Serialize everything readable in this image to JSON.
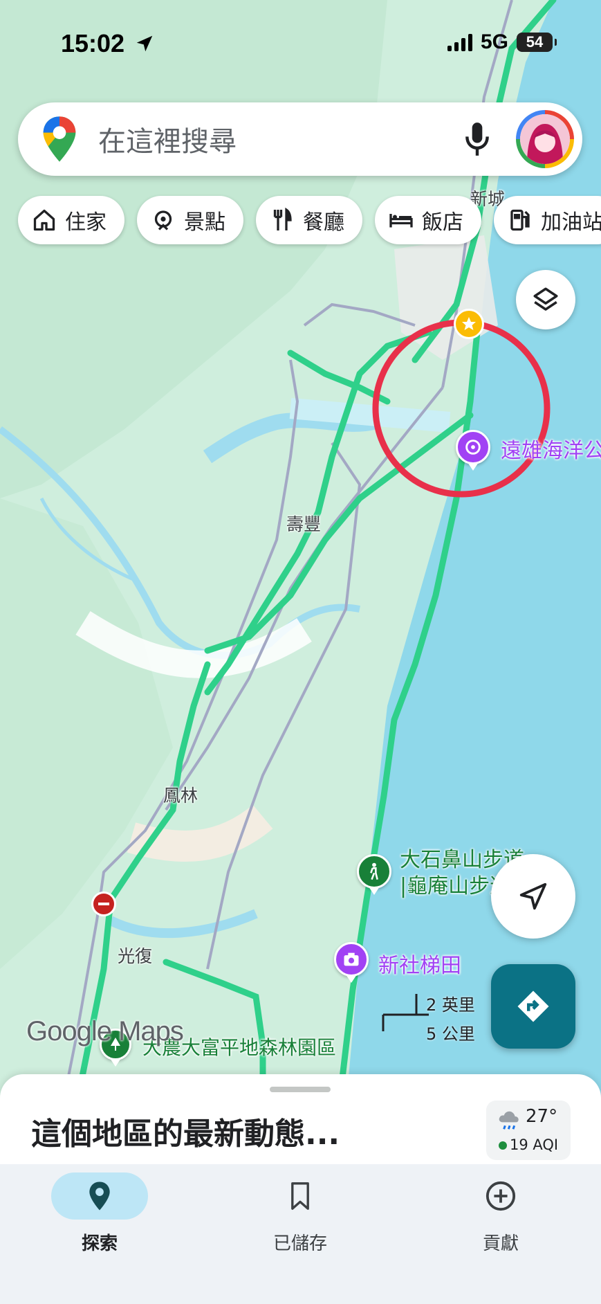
{
  "status_bar": {
    "time": "15:02",
    "network": "5G",
    "battery": "54"
  },
  "search": {
    "placeholder": "在這裡搜尋"
  },
  "chips": [
    {
      "label": "住家",
      "icon": "home-icon"
    },
    {
      "label": "景點",
      "icon": "attraction-icon"
    },
    {
      "label": "餐廳",
      "icon": "restaurant-icon"
    },
    {
      "label": "飯店",
      "icon": "hotel-icon"
    },
    {
      "label": "加油站",
      "icon": "gas-station-icon"
    }
  ],
  "map": {
    "place_labels": [
      "新城",
      "壽豐",
      "鳳林",
      "光復"
    ],
    "pois": [
      {
        "label": "遠雄海洋公園",
        "color": "#a142f4",
        "icon": "amusement-park-icon"
      },
      {
        "label": "大石鼻山步道",
        "label2": "|龜庵山步道",
        "color": "#188038",
        "icon": "hiking-icon"
      },
      {
        "label": "新社梯田",
        "color": "#a142f4",
        "icon": "camera-icon"
      },
      {
        "label": "大農大富平地森林園區",
        "color": "#188038",
        "icon": "park-icon"
      }
    ],
    "scale": {
      "imperial": "2 英里",
      "metric": "5 公里"
    },
    "watermark": "Google Maps",
    "water_color": "#8fd8ea",
    "land_color": "#cfeedd",
    "traffic_color": "#2fd08a",
    "highlight_circle_color": "#e8304a"
  },
  "sheet": {
    "title": "這個地區的最新動態...",
    "temperature": "27°",
    "aqi": "19 AQI"
  },
  "bottom_nav": [
    {
      "label": "探索",
      "icon": "explore-pin-icon",
      "active": true
    },
    {
      "label": "已儲存",
      "icon": "bookmark-icon",
      "active": false
    },
    {
      "label": "貢獻",
      "icon": "add-circle-icon",
      "active": false
    }
  ]
}
